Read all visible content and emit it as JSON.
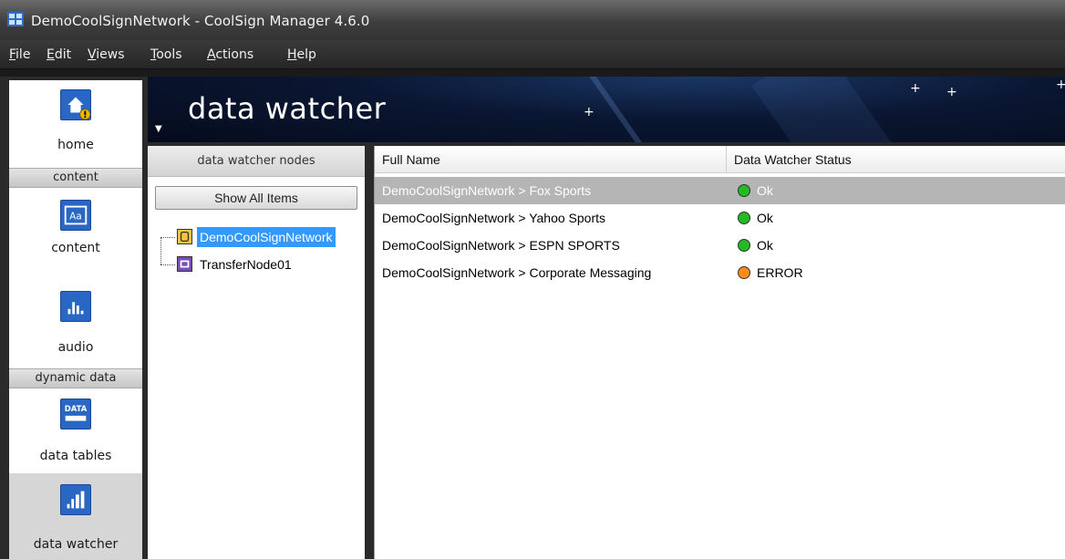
{
  "window": {
    "title": "DemoCoolSignNetwork - CoolSign Manager 4.6.0"
  },
  "menu": [
    {
      "label": "File",
      "hotkey": "F",
      "rest": "ile"
    },
    {
      "label": "Edit",
      "hotkey": "E",
      "rest": "dit"
    },
    {
      "label": "Views",
      "hotkey": "V",
      "rest": "iews"
    },
    {
      "label": "Tools",
      "hotkey": "T",
      "rest": "ools"
    },
    {
      "label": "Actions",
      "hotkey": "A",
      "rest": "ctions"
    },
    {
      "label": "Help",
      "hotkey": "H",
      "rest": "elp"
    }
  ],
  "nav": {
    "home": {
      "label": "home",
      "icon": "home-icon"
    },
    "sections": {
      "content": "content",
      "dynamic_data": "dynamic data"
    },
    "content": {
      "label": "content",
      "icon": "content-icon"
    },
    "audio": {
      "label": "audio",
      "icon": "audio-icon"
    },
    "data_tables": {
      "label": "data tables",
      "icon": "data-tables-icon",
      "icon_text": "DATA"
    },
    "data_watcher": {
      "label": "data watcher",
      "icon": "data-watcher-icon",
      "selected": true
    }
  },
  "banner": {
    "title": "data watcher"
  },
  "nodes": {
    "header": "data watcher nodes",
    "show_all": "Show All Items",
    "tree": [
      {
        "label": "DemoCoolSignNetwork",
        "icon": "network-icon",
        "selected": true
      },
      {
        "label": "TransferNode01",
        "icon": "transfer-node-icon",
        "selected": false
      }
    ]
  },
  "list": {
    "columns": [
      "Full Name",
      "Data Watcher Status"
    ],
    "rows": [
      {
        "name": "DemoCoolSignNetwork > Fox Sports",
        "status": "Ok",
        "status_color": "#22bb22",
        "selected": true
      },
      {
        "name": "DemoCoolSignNetwork > Yahoo Sports",
        "status": "Ok",
        "status_color": "#22bb22",
        "selected": false
      },
      {
        "name": "DemoCoolSignNetwork > ESPN SPORTS",
        "status": "Ok",
        "status_color": "#22bb22",
        "selected": false
      },
      {
        "name": "DemoCoolSignNetwork > Corporate Messaging",
        "status": "ERROR",
        "status_color": "#ff8c1a",
        "selected": false
      }
    ]
  }
}
